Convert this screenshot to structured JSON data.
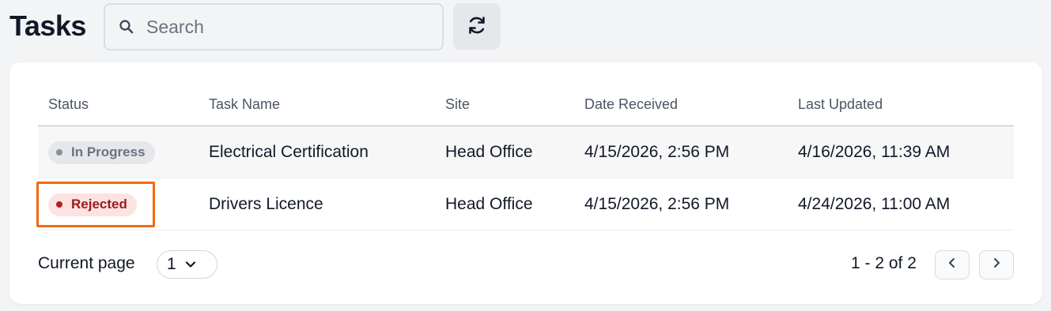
{
  "header": {
    "title": "Tasks",
    "search_placeholder": "Search",
    "search_value": "",
    "search_icon": "search-icon",
    "refresh_icon": "refresh-icon"
  },
  "table": {
    "columns": [
      "Status",
      "Task Name",
      "Site",
      "Date Received",
      "Last Updated"
    ],
    "rows": [
      {
        "status": "In Progress",
        "task_name": "Electrical Certification",
        "site": "Head Office",
        "date_received": "4/15/2026, 2:56 PM",
        "last_updated": "4/16/2026, 11:39 AM"
      },
      {
        "status": "Rejected",
        "task_name": "Drivers Licence",
        "site": "Head Office",
        "date_received": "4/15/2026, 2:56 PM",
        "last_updated": "4/24/2026, 11:00 AM"
      }
    ]
  },
  "footer": {
    "current_page_label": "Current page",
    "current_page_value": "1",
    "range_text": "1 - 2 of 2",
    "prev_icon": "chevron-left-icon",
    "next_icon": "chevron-right-icon"
  },
  "colors": {
    "background": "#f3f4f6",
    "card": "#ffffff",
    "status_in_progress": "#6b7280",
    "status_rejected": "#991b1b",
    "highlight": "#f06a0f"
  }
}
